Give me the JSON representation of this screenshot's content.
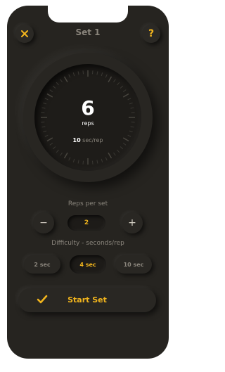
{
  "header": {
    "close_icon": "close-icon",
    "title": "Set 1",
    "help_label": "?"
  },
  "dial": {
    "count": "6",
    "unit": "reps",
    "rate_value": "10",
    "rate_unit": " sec/rep"
  },
  "reps_per_set": {
    "label": "Reps per set",
    "minus": "−",
    "value": "2",
    "plus": "+"
  },
  "difficulty": {
    "label": "Difficulty - seconds/rep",
    "options": [
      "2 sec",
      "4 sec",
      "10 sec"
    ],
    "selected": "4 sec"
  },
  "start": {
    "label": "Start Set",
    "icon": "check-icon"
  },
  "colors": {
    "background": "#262420",
    "accent": "#f2b51d",
    "muted_text": "#8a857c"
  }
}
